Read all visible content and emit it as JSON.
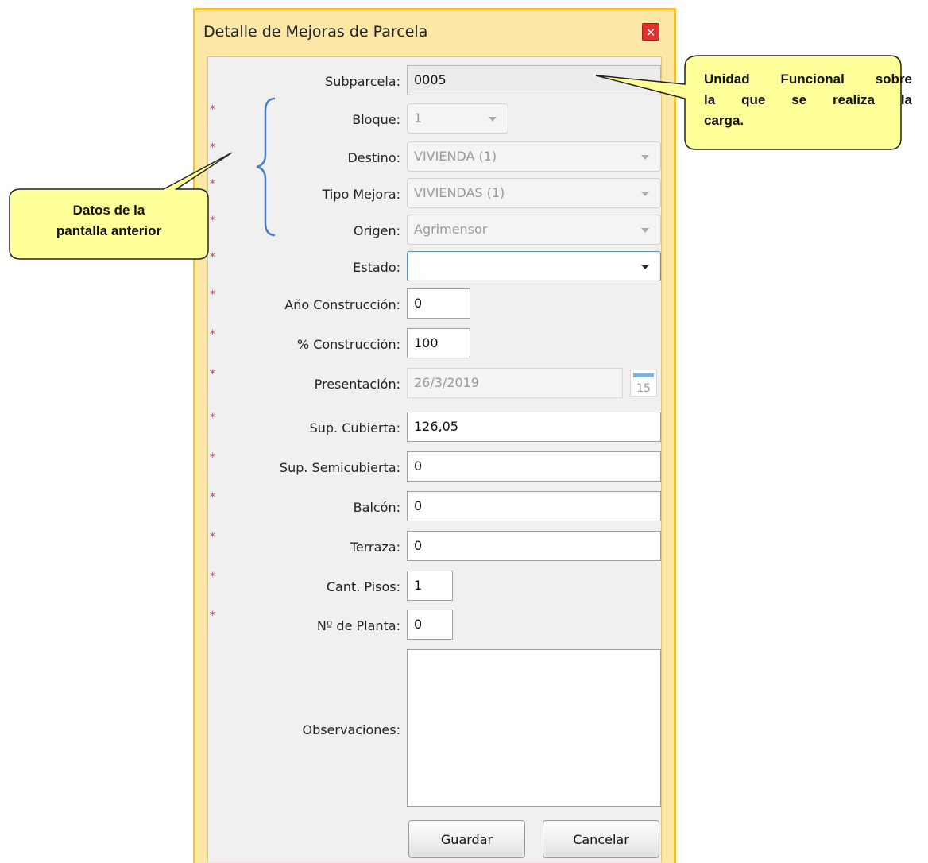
{
  "dialog": {
    "title": "Detalle de Mejoras de Parcela",
    "close_symbol": "✕"
  },
  "form": {
    "required_marker": "*",
    "subparcela": {
      "label": "Subparcela:",
      "value": "0005"
    },
    "bloque": {
      "label": "Bloque:",
      "value": "1"
    },
    "destino": {
      "label": "Destino:",
      "value": "VIVIENDA (1)"
    },
    "tipo_mejora": {
      "label": "Tipo Mejora:",
      "value": "VIVIENDAS (1)"
    },
    "origen": {
      "label": "Origen:",
      "value": "Agrimensor"
    },
    "estado": {
      "label": "Estado:",
      "value": ""
    },
    "anio_construccion": {
      "label": "Año Construcción:",
      "value": "0"
    },
    "pct_construccion": {
      "label": "% Construcción:",
      "value": "100"
    },
    "presentacion": {
      "label": "Presentación:",
      "value": "26/3/2019",
      "calendar_day": "15"
    },
    "sup_cubierta": {
      "label": "Sup. Cubierta:",
      "value": "126,05"
    },
    "sup_semicubierta": {
      "label": "Sup. Semicubierta:",
      "value": "0"
    },
    "balcon": {
      "label": "Balcón:",
      "value": "0"
    },
    "terraza": {
      "label": "Terraza:",
      "value": "0"
    },
    "cant_pisos": {
      "label": "Cant. Pisos:",
      "value": "1"
    },
    "nro_planta": {
      "label": "Nº de Planta:",
      "value": "0"
    },
    "observaciones": {
      "label": "Observaciones:",
      "value": ""
    }
  },
  "buttons": {
    "save": "Guardar",
    "cancel": "Cancelar"
  },
  "callouts": {
    "right_line1": "Unidad Funcional sobre",
    "right_line2": "la que se realiza la",
    "right_line3": "carga.",
    "left_line1": "Datos de la",
    "left_line2": "pantalla anterior"
  },
  "colors": {
    "callout_fill": "#ffff99",
    "bracket": "#4a7fc1",
    "required": "#e53935",
    "dialog_border": "#f2c32e"
  }
}
